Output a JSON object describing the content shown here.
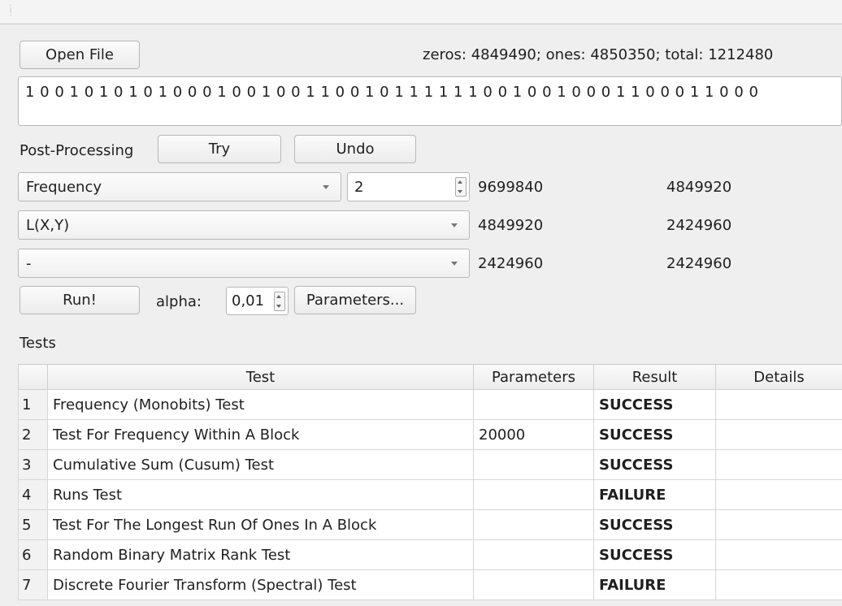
{
  "file": {
    "open_label": "Open File",
    "stats": "zeros: 4849490; ones: 4850350; total: 1212480",
    "bits": "1 0 0 1 0 1 0 1 0 1 0 0 0 1 0 0 1 0 0 1 1 0 0 1 0 1 1 1 1 1 1 0 0 1 0 0 1 0 0 0 1 1 0 0 0 1 1 0 0 0"
  },
  "postprocessing": {
    "label": "Post-Processing",
    "try_label": "Try",
    "undo_label": "Undo",
    "rows": [
      {
        "method": "Frequency",
        "param": "2",
        "in": "9699840",
        "out": "4849920"
      },
      {
        "method": "L(X,Y)",
        "in": "4849920",
        "out": "2424960"
      },
      {
        "method": "-",
        "in": "2424960",
        "out": "2424960"
      }
    ]
  },
  "run": {
    "run_label": "Run!",
    "alpha_label": "alpha:",
    "alpha_value": "0,01",
    "parameters_label": "Parameters..."
  },
  "tests": {
    "heading": "Tests",
    "columns": [
      "Test",
      "Parameters",
      "Result",
      "Details"
    ],
    "rows": [
      {
        "n": "1",
        "test": "Frequency (Monobits) Test",
        "params": "",
        "result": "SUCCESS",
        "details": ""
      },
      {
        "n": "2",
        "test": "Test For Frequency Within A Block",
        "params": "20000",
        "result": "SUCCESS",
        "details": ""
      },
      {
        "n": "3",
        "test": "Cumulative Sum (Cusum) Test",
        "params": "",
        "result": "SUCCESS",
        "details": ""
      },
      {
        "n": "4",
        "test": "Runs Test",
        "params": "",
        "result": "FAILURE",
        "details": ""
      },
      {
        "n": "5",
        "test": "Test For The Longest Run Of Ones In A Block",
        "params": "",
        "result": "SUCCESS",
        "details": ""
      },
      {
        "n": "6",
        "test": "Random Binary Matrix Rank Test",
        "params": "",
        "result": "SUCCESS",
        "details": ""
      },
      {
        "n": "7",
        "test": "Discrete Fourier Transform (Spectral) Test",
        "params": "",
        "result": "FAILURE",
        "details": ""
      }
    ]
  }
}
